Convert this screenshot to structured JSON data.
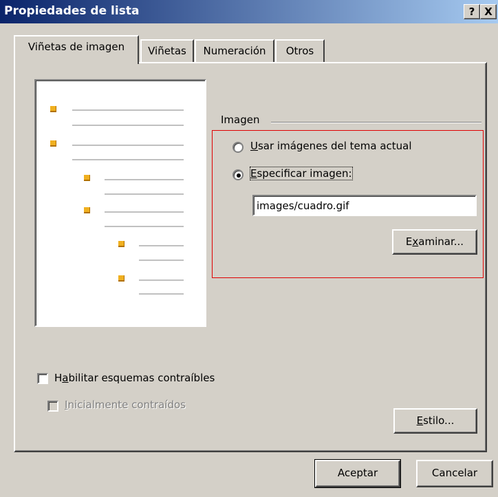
{
  "window": {
    "title": "Propiedades de lista",
    "help_button": "?",
    "close_button": "X"
  },
  "tabs": [
    {
      "label": "Viñetas de imagen",
      "active": true
    },
    {
      "label": "Viñetas",
      "active": false
    },
    {
      "label": "Numeración",
      "active": false
    },
    {
      "label": "Otros",
      "active": false
    }
  ],
  "image_group": {
    "label": "Imagen",
    "option_theme": {
      "label": "Usar imágenes del tema actual",
      "accel": "U",
      "rest": "sar imágenes del tema actual",
      "selected": false
    },
    "option_specify": {
      "label": "Especificar imagen:",
      "accel": "E",
      "rest": "specificar imagen:",
      "selected": true
    },
    "image_path": "images/cuadro.gif",
    "browse_button": {
      "label": "Examinar...",
      "pre": "E",
      "accel": "x",
      "rest": "aminar..."
    }
  },
  "options": {
    "enable_collapsible": {
      "label": "Habilitar esquemas contraíbles",
      "pre": "H",
      "accel": "a",
      "rest": "bilitar esquemas contraíbles",
      "checked": false
    },
    "initially_collapsed": {
      "label": "Inicialmente contraídos",
      "accel": "I",
      "rest": "nicialmente contraídos",
      "checked": false,
      "disabled": true
    }
  },
  "style_button": {
    "label": "Estilo...",
    "accel": "E",
    "rest": "stilo..."
  },
  "footer": {
    "ok_label": "Aceptar",
    "cancel_label": "Cancelar"
  },
  "colors": {
    "dialog_bg": "#d4d0c8",
    "title_start": "#0a246a",
    "title_end": "#a6caf0",
    "bullet": "#f0b020",
    "highlight_box": "#e00000"
  }
}
